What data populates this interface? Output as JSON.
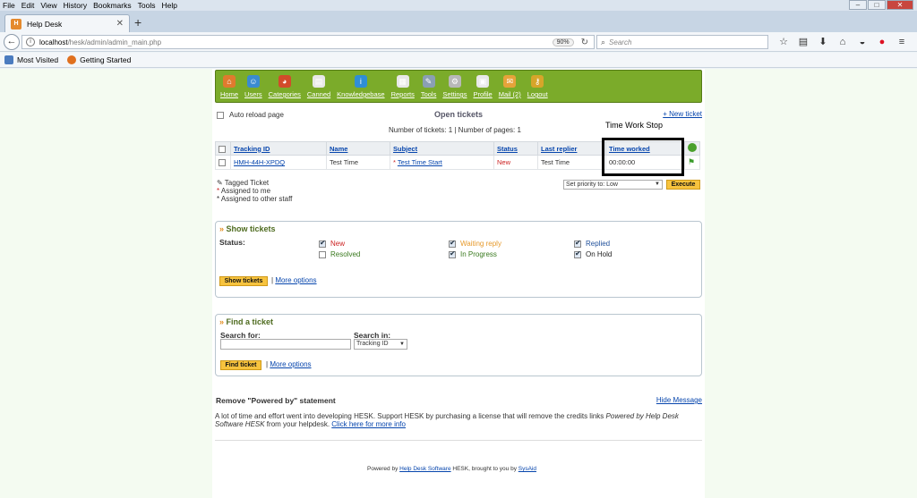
{
  "menubar": {
    "items": [
      "File",
      "Edit",
      "View",
      "History",
      "Bookmarks",
      "Tools",
      "Help"
    ],
    "accel": [
      "F",
      "E",
      "V",
      "H",
      "B",
      "T",
      "H"
    ]
  },
  "browser": {
    "tab_title": "Help Desk",
    "url_host": "localhost",
    "url_path": "/hesk/admin/admin_main.php",
    "zoom": "90%",
    "search_placeholder": "Search"
  },
  "bookmarks": [
    "Most Visited",
    "Getting Started"
  ],
  "nav": [
    {
      "label": "Home",
      "icon": "home-icon",
      "color": "#e07a2e"
    },
    {
      "label": "Users",
      "icon": "users-icon",
      "color": "#3a8bd0"
    },
    {
      "label": "Categories",
      "icon": "categories-icon",
      "color": "#d24b2a"
    },
    {
      "label": "Canned",
      "icon": "canned-icon",
      "color": "#e8e8e8"
    },
    {
      "label": "Knowledgebase",
      "icon": "info-icon",
      "color": "#2f8ed6"
    },
    {
      "label": "Reports",
      "icon": "reports-icon",
      "color": "#e8e8e8"
    },
    {
      "label": "Tools",
      "icon": "tools-icon",
      "color": "#8a9fb3"
    },
    {
      "label": "Settings",
      "icon": "gear-icon",
      "color": "#b8b8b8"
    },
    {
      "label": "Profile",
      "icon": "profile-icon",
      "color": "#e8e8e8"
    },
    {
      "label": "Mail (2)",
      "icon": "mail-icon",
      "color": "#e6a33a"
    },
    {
      "label": "Logout",
      "icon": "key-icon",
      "color": "#d7a52a"
    }
  ],
  "tickets": {
    "auto_reload": "Auto reload page",
    "title": "Open tickets",
    "new_ticket": "+ New ticket",
    "counts": "Number of tickets: 1 | Number of pages: 1",
    "columns": [
      "Tracking ID",
      "Name",
      "Subject",
      "Status",
      "Last replier",
      "Time worked"
    ],
    "rows": [
      {
        "id": "HMH-44H-XPDQ",
        "name": "Test Time",
        "subject": "Test Time Start",
        "status": "New",
        "last_replier": "Test Time",
        "time_worked": "00:00:00"
      }
    ],
    "annotation": "Time Work Stop",
    "legend": [
      "Tagged Ticket",
      "Assigned to me",
      "Assigned to other staff"
    ],
    "priority_select": "Set priority to: Low",
    "execute": "Execute"
  },
  "show_tickets": {
    "title": "Show tickets",
    "status_label": "Status:",
    "options": [
      {
        "label": "New",
        "checked": true,
        "color": "#c22"
      },
      {
        "label": "Waiting reply",
        "checked": true,
        "color": "#e69a2c"
      },
      {
        "label": "Replied",
        "checked": true,
        "color": "#1f4f9a"
      },
      {
        "label": "Resolved",
        "checked": false,
        "color": "#3a7a1f"
      },
      {
        "label": "In Progress",
        "checked": true,
        "color": "#3a7a1f"
      },
      {
        "label": "On Hold",
        "checked": true,
        "color": "#222"
      }
    ],
    "button": "Show tickets",
    "more": "More options"
  },
  "find_ticket": {
    "title": "Find a ticket",
    "search_for": "Search for:",
    "search_in": "Search in:",
    "search_in_value": "Tracking ID",
    "button": "Find ticket",
    "more": "More options"
  },
  "powered": {
    "title": "Remove \"Powered by\" statement",
    "hide": "Hide Message",
    "text_a": "A lot of time and effort went into developing HESK. Support HESK by purchasing a license that will remove the credits links ",
    "text_italic": "Powered by Help Desk Software HESK",
    "text_b": " from your helpdesk. ",
    "link": "Click here for more info",
    "footer_a": "Powered by ",
    "footer_link": "Help Desk Software",
    "footer_b": " HESK, brought to you by ",
    "footer_link2": "SysAid"
  }
}
